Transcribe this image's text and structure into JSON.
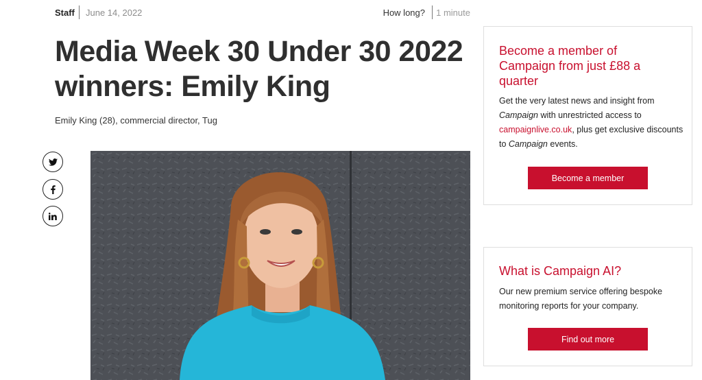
{
  "article": {
    "author": "Staff",
    "date": "June 14, 2022",
    "how_long_label": "How long?",
    "read_time": "1 minute",
    "headline": "Media Week 30 Under 30 2022 winners: Emily King",
    "standfirst": "Emily King (28), commercial director, Tug"
  },
  "share": {
    "twitter_icon": "twitter-icon",
    "facebook_icon": "facebook-icon",
    "linkedin_icon": "linkedin-icon"
  },
  "promos": {
    "membership": {
      "title": "Become a member of Campaign from just £88 a quarter",
      "body_1": "Get the very latest news and insight from ",
      "brand_1": "Campaign",
      "body_2": " with unrestricted access to ",
      "link": "campaignlive.co.uk",
      "body_3": ", plus get exclusive discounts to ",
      "brand_2": "Campaign",
      "body_4": " events.",
      "button": "Become a member"
    },
    "ai": {
      "title": "What is Campaign AI?",
      "body": "Our new premium service offering bespoke monitoring reports for your company.",
      "button": "Find out more"
    }
  },
  "colors": {
    "accent": "#c8102e",
    "headline": "#2f2f2f"
  }
}
